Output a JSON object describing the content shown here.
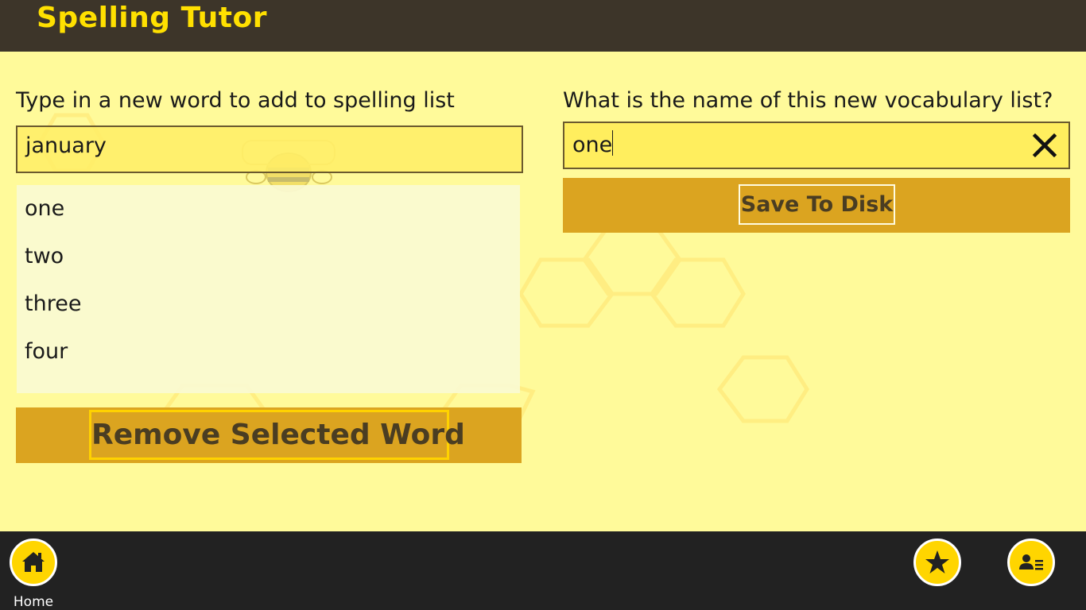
{
  "app": {
    "title": "Spelling Tutor"
  },
  "word_entry": {
    "label": "Type in a new word to add to spelling list",
    "value": "january"
  },
  "word_list": {
    "items": [
      "one",
      "two",
      "three",
      "four"
    ]
  },
  "remove_button": {
    "label": "Remove Selected Word"
  },
  "list_name": {
    "label": "What is the name of this new vocabulary list?",
    "value": "one",
    "clear_icon": "close-icon"
  },
  "save_button": {
    "label": "Save To Disk"
  },
  "bottom_bar": {
    "home_label": "Home",
    "home_icon": "home-icon",
    "star_icon": "star-icon",
    "contact_icon": "contact-card-icon"
  },
  "colors": {
    "header_bg": "#3d3529",
    "title_color": "#ffe000",
    "content_bg": "#fffa9a",
    "button_panel": "#dba420",
    "bottom_bar_bg": "#222222",
    "circle_button": "#ffd500"
  }
}
